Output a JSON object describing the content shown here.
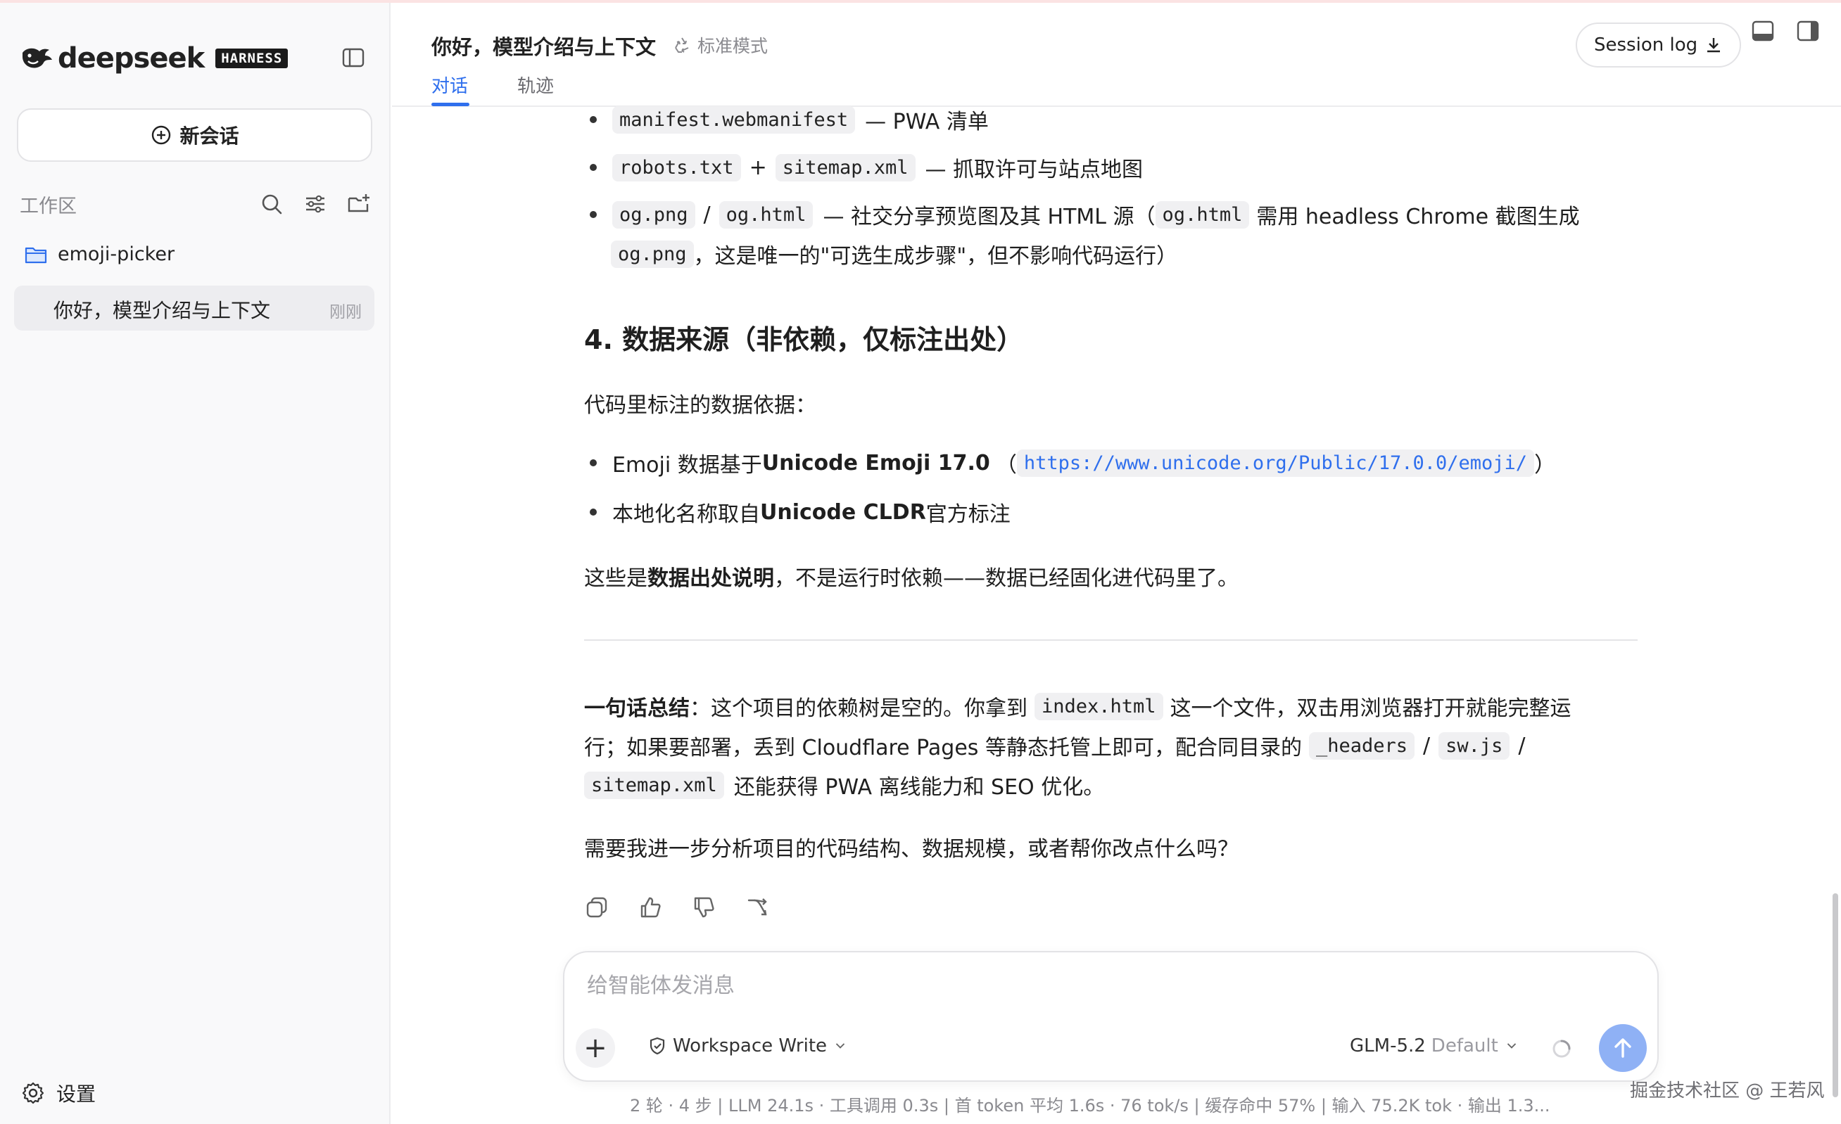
{
  "brand": {
    "name": "deepseek",
    "badge": "HARNESS"
  },
  "sidebar": {
    "new_chat_label": "新会话",
    "workspace_label": "工作区",
    "folder_name": "emoji-picker",
    "session": {
      "title": "你好，模型介绍与上下文",
      "time": "刚刚"
    },
    "settings_label": "设置"
  },
  "header": {
    "title": "你好，模型介绍与上下文",
    "mode": "标准模式",
    "tabs": [
      {
        "label": "对话",
        "active": true
      },
      {
        "label": "轨迹",
        "active": false
      }
    ],
    "session_log_label": "Session log"
  },
  "content": {
    "bullets_top": [
      {
        "code1": "manifest.webmanifest",
        "text": "— PWA 清单"
      },
      {
        "code1": "robots.txt",
        "sep": "+",
        "code2": "sitemap.xml",
        "text": "— 抓取许可与站点地图"
      },
      {
        "code1": "og.png",
        "sep": "/",
        "code2": "og.html",
        "text": "— 社交分享预览图及其 HTML 源（",
        "code3": "og.html",
        "text2": "需用 headless Chrome 截图生成",
        "line2_code": "og.png",
        "line2_text": "，这是唯一的\"可选生成步骤\"，但不影响代码运行）"
      }
    ],
    "heading": "4. 数据来源（非依赖，仅标注出处）",
    "intro": "代码里标注的数据依据：",
    "source_bullets": [
      {
        "pre": "Emoji 数据基于 ",
        "bold": "Unicode Emoji 17.0",
        "mid": "（",
        "link": "https://www.unicode.org/Public/17.0.0/emoji/",
        "post": "）"
      },
      {
        "pre": "本地化名称取自 ",
        "bold": "Unicode CLDR",
        "post": " 官方标注"
      }
    ],
    "note": {
      "pre": "这些是",
      "bold": "数据出处说明",
      "post": "，不是运行时依赖——数据已经固化进代码里了。"
    },
    "summary": {
      "bold": "一句话总结",
      "l1a": "：这个项目的依赖树是空的。你拿到",
      "l1code": "index.html",
      "l1b": "这一个文件，双击用浏览器打开就能完整运",
      "l2a": "行；如果要部署，丢到 Cloudflare Pages 等静态托管上即可，配合同目录的",
      "l2code1": "_headers",
      "l2sep1": "/",
      "l2code2": "sw.js",
      "l2sep2": "/",
      "l3code": "sitemap.xml",
      "l3b": "还能获得 PWA 离线能力和 SEO 优化。"
    },
    "question": "需要我进一步分析项目的代码结构、数据规模，或者帮你改点什么吗？"
  },
  "composer": {
    "placeholder": "给智能体发消息",
    "permission": "Workspace Write",
    "model": "GLM-5.2",
    "model_tag": "Default"
  },
  "stats": "2 轮 · 4 步  |  LLM 24.1s · 工具调用 0.3s  |  首 token 平均 1.6s · 76 tok/s  |  缓存命中 57%  |  输入 75.2K tok · 输出 1.3...",
  "watermark": "掘金技术社区 @ 王若风",
  "colors": {
    "accent": "#2f6fed",
    "send_button": "#8fb1f5",
    "sidebar_bg": "#f9f9fa"
  }
}
